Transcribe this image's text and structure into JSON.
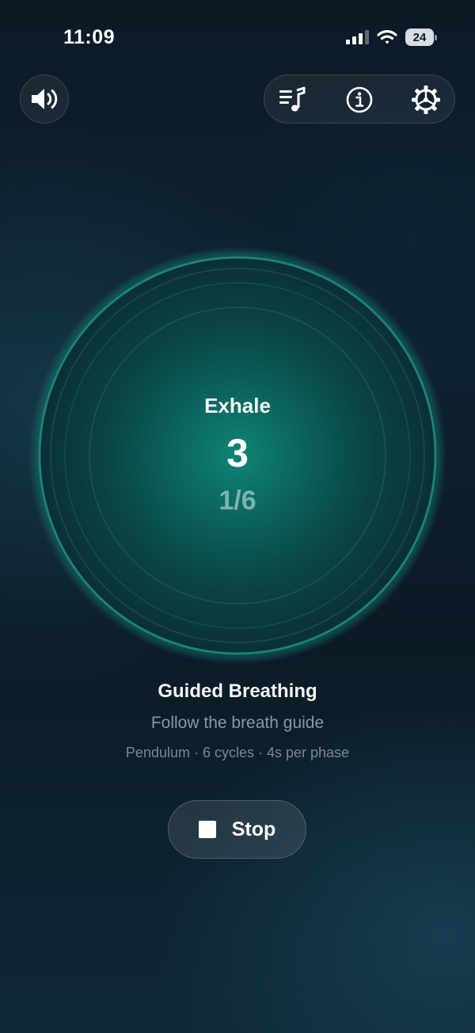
{
  "status_bar": {
    "time": "11:09",
    "battery_level": "24",
    "icons": [
      "cellular-signal-icon",
      "wifi-icon",
      "battery-icon"
    ]
  },
  "toolbar": {
    "sound_icon": "speaker-volume-icon",
    "buttons": [
      {
        "name": "playlist-music-button",
        "icon": "playlist-music-icon"
      },
      {
        "name": "info-button",
        "icon": "info-icon"
      },
      {
        "name": "settings-button",
        "icon": "gear-icon"
      }
    ]
  },
  "breath": {
    "phase": "Exhale",
    "count": "3",
    "progress": "1/6"
  },
  "exercise": {
    "title": "Guided Breathing",
    "subtitle": "Follow the breath guide",
    "meta": "Pendulum · 6 cycles · 4s per phase"
  },
  "actions": {
    "stop_label": "Stop"
  },
  "colors": {
    "accent_teal": "#0f8a7c",
    "ring": "#1e7f75",
    "background": "#0d1c28"
  }
}
